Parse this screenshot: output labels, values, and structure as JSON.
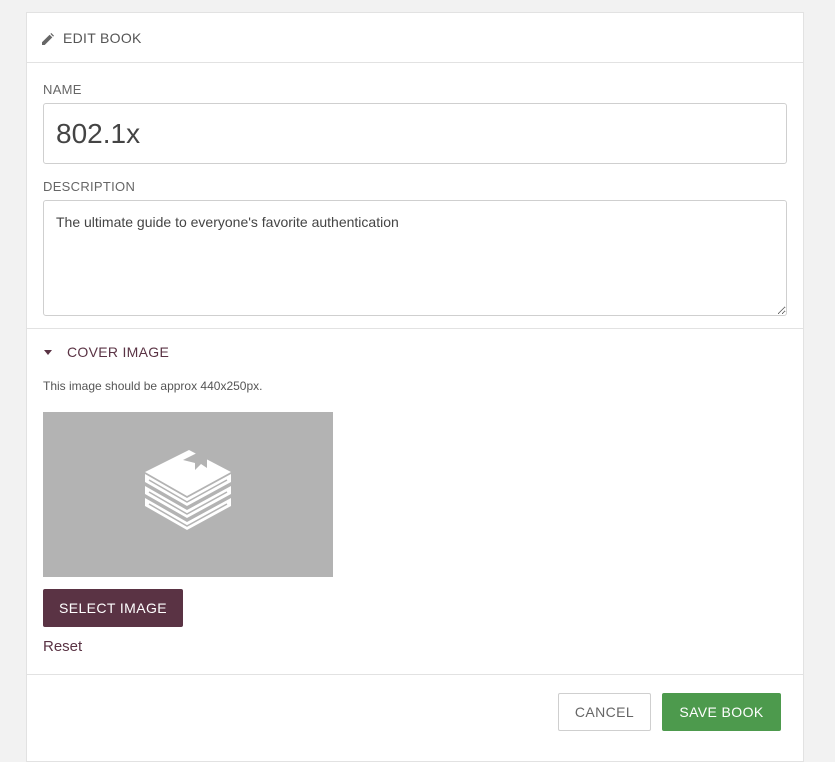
{
  "header": {
    "title": "EDIT BOOK",
    "icon": "pencil-icon"
  },
  "form": {
    "name_label": "NAME",
    "name_value": "802.1x",
    "description_label": "DESCRIPTION",
    "description_value": "The ultimate guide to everyone's favorite authentication"
  },
  "cover": {
    "toggle_label": "COVER IMAGE",
    "toggle_icon": "caret-down-icon",
    "hint": "This image should be approx 440x250px.",
    "placeholder_icon": "book-stack-icon",
    "select_label": "SELECT IMAGE",
    "reset_label": "Reset"
  },
  "footer": {
    "cancel_label": "CANCEL",
    "save_label": "SAVE BOOK"
  },
  "colors": {
    "accent": "#5a3344",
    "save": "#4d9a4d",
    "placeholder_bg": "#b3b3b3"
  }
}
